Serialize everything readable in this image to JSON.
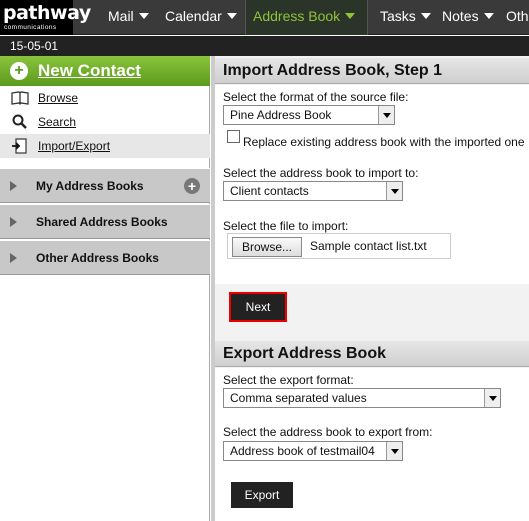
{
  "nav": {
    "logo_word": "pathway",
    "logo_sub": "communications",
    "items": [
      {
        "label": "Mail"
      },
      {
        "label": "Calendar"
      },
      {
        "label": "Address Book"
      },
      {
        "label": "Tasks"
      },
      {
        "label": "Notes"
      },
      {
        "label": "Oth"
      }
    ],
    "active_color": "#8fc33a"
  },
  "date": "15-05-01",
  "sidebar": {
    "new_contact": "New Contact",
    "links": [
      {
        "label": "Browse",
        "icon": "book-icon"
      },
      {
        "label": "Search",
        "icon": "magnifier-icon"
      },
      {
        "label": "Import/Export",
        "icon": "import-export-icon"
      }
    ],
    "sections": [
      {
        "label": "My Address Books"
      },
      {
        "label": "Shared Address Books"
      },
      {
        "label": "Other Address Books"
      }
    ]
  },
  "import": {
    "title": "Import Address Book, Step 1",
    "format_label": "Select the format of the source file:",
    "format_value": "Pine Address Book",
    "replace_label": "Replace existing address book with the imported one",
    "replace_checked": false,
    "book_label": "Select the address book to import to:",
    "book_value": "Client contacts",
    "file_label": "Select the file to import:",
    "browse_label": "Browse...",
    "file_name": "Sample contact list.txt",
    "next_label": "Next"
  },
  "export": {
    "title": "Export Address Book",
    "format_label": "Select the export format:",
    "format_value": "Comma separated values",
    "book_label": "Select the address book to export from:",
    "book_value": "Address book of testmail04",
    "export_label": "Export"
  }
}
